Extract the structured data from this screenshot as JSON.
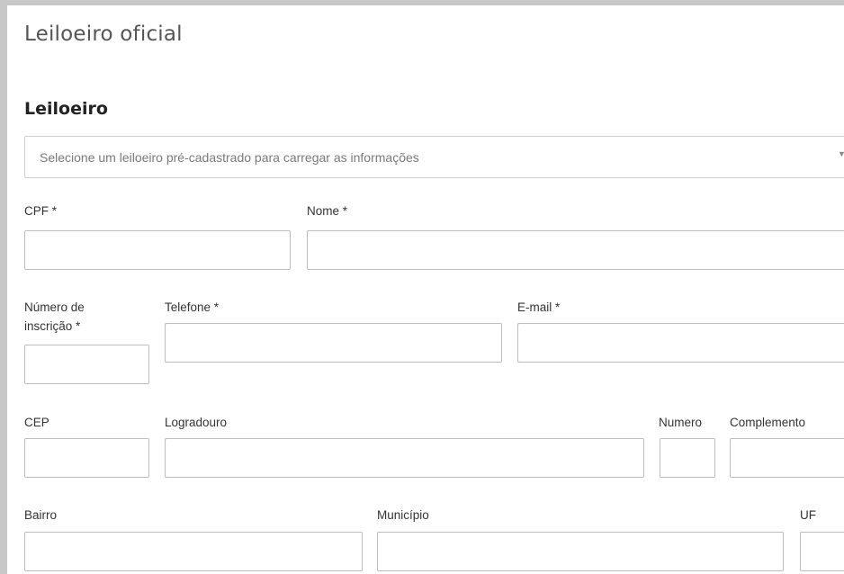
{
  "panel": {
    "title": "Leiloeiro oficial"
  },
  "section": {
    "title": "Leiloeiro"
  },
  "select": {
    "placeholder": "Selecione um leiloeiro pré-cadastrado para carregar as informações",
    "arrow_icon": "caret-down-icon"
  },
  "fields": {
    "cpf": {
      "label": "CPF *",
      "value": ""
    },
    "nome": {
      "label": "Nome *",
      "value": ""
    },
    "numero_inscricao": {
      "label_line1": "Número de",
      "label_line2": "inscrição *",
      "value": ""
    },
    "telefone": {
      "label": "Telefone *",
      "value": ""
    },
    "email": {
      "label": "E-mail *",
      "value": ""
    },
    "cep": {
      "label": "CEP",
      "value": ""
    },
    "logradouro": {
      "label": "Logradouro",
      "value": ""
    },
    "numero": {
      "label": "Numero",
      "value": ""
    },
    "complemento": {
      "label": "Complemento",
      "value": ""
    },
    "bairro": {
      "label": "Bairro",
      "value": ""
    },
    "municipio": {
      "label": "Município",
      "value": ""
    },
    "uf": {
      "label": "UF",
      "value": ""
    }
  }
}
